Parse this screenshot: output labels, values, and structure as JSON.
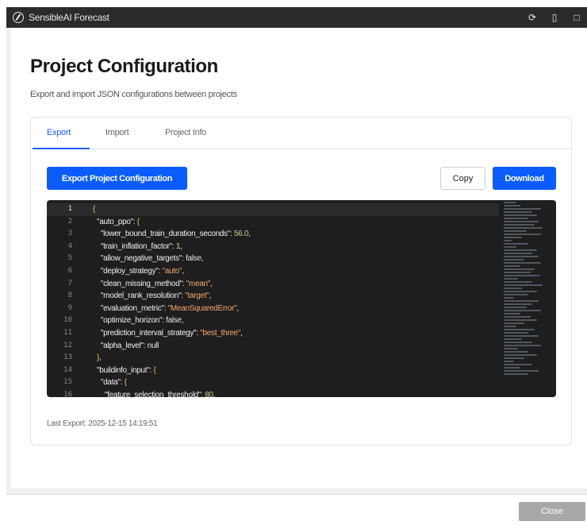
{
  "app": {
    "title": "SensibleAI Forecast"
  },
  "header": {
    "title": "Project Configuration",
    "subtitle": "Export and import JSON configurations between projects"
  },
  "tabs": [
    {
      "label": "Export",
      "active": true
    },
    {
      "label": "Import",
      "active": false
    },
    {
      "label": "Project Info",
      "active": false
    }
  ],
  "toolbar": {
    "export_label": "Export Project Configuration",
    "copy_label": "Copy",
    "download_label": "Download"
  },
  "editor": {
    "line_numbers": [
      "1",
      "2",
      "3",
      "4",
      "5",
      "6",
      "7",
      "8",
      "9",
      "10",
      "11",
      "12",
      "13",
      "14",
      "15",
      "16"
    ],
    "lines": [
      "{",
      "  \"auto_ppo\": {",
      "    \"lower_bound_train_duration_seconds\": 56.0,",
      "    \"train_inflation_factor\": 1,",
      "    \"allow_negative_targets\": false,",
      "    \"deploy_strategy\": \"auto\",",
      "    \"clean_missing_method\": \"mean\",",
      "    \"model_rank_resolution\": \"target\",",
      "    \"evaluation_metric\": \"MeanSquaredError\",",
      "    \"optimize_horizon\": false,",
      "    \"prediction_interval_strategy\": \"best_three\",",
      "    \"alpha_level\": null",
      "  },",
      "  \"buildinfo_input\": {",
      "    \"data\": {",
      "      \"feature_selection_threshold\": 80,"
    ]
  },
  "status": {
    "last_export": "Last Export: 2025-12-15 14:19:51"
  },
  "footer": {
    "close_label": "Close"
  },
  "colors": {
    "accent": "#0a5cff",
    "titlebar": "#2b2b2b",
    "editor_bg": "#1e1e1e"
  }
}
